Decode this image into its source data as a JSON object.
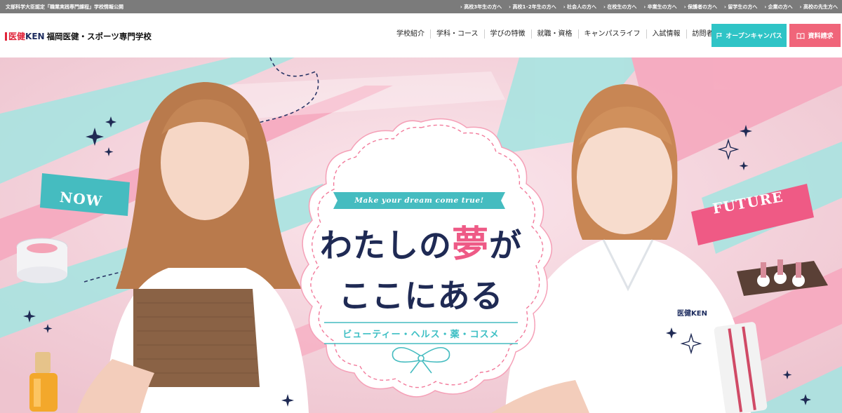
{
  "topbar": {
    "certification": "文部科学大臣認定「職業実践専門課程」学校情報公開",
    "audience_links": [
      "高校3年生の方へ",
      "高校1･2年生の方へ",
      "社会人の方へ",
      "在校生の方へ",
      "卒業生の方へ",
      "保護者の方へ",
      "留学生の方へ",
      "企業の方へ",
      "高校の先生方へ"
    ]
  },
  "header": {
    "logo": {
      "mark_red": "医健",
      "mark_navy": "KEN",
      "school_name": "福岡医健・スポーツ専門学校"
    },
    "nav": [
      "学校紹介",
      "学科・コース",
      "学びの特徴",
      "就職・資格",
      "キャンパスライフ",
      "入試情報",
      "訪問者別"
    ],
    "open_campus_label": "オープンキャンパス",
    "request_docs_label": "資料請求"
  },
  "hero": {
    "tagline": "Make your dream come true!",
    "headline_part1": "わたしの",
    "headline_highlight": "夢",
    "headline_part2": "が",
    "headline_line2": "ここにある",
    "subtitle": "ビューティー・ヘルス・薬・コスメ",
    "label_now": "NOW",
    "label_future": "FUTURE",
    "uniform_logo": "医健KEN"
  },
  "colors": {
    "topbar_bg": "#7b7b7b",
    "open_campus_bg": "#2fc4c6",
    "request_docs_bg": "#f0657a",
    "headline_navy": "#1f2a54",
    "headline_pink": "#ee5a86",
    "accent_teal": "#3dbfc4",
    "accent_pink": "#f27a9b"
  }
}
